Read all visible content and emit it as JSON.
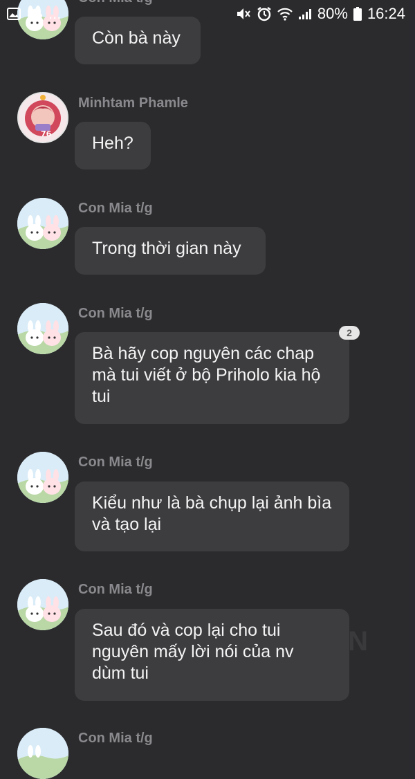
{
  "status_bar": {
    "battery": "80%",
    "time": "16:24",
    "left_text": "..."
  },
  "watermark": "ON",
  "messages": [
    {
      "sender": "Con Mia t/g",
      "text": "Còn bà này"
    },
    {
      "sender": "Minhtam Phamle",
      "text": "Heh?"
    },
    {
      "sender": "Con Mia t/g",
      "text": "Trong thời gian này"
    },
    {
      "sender": "Con Mia t/g",
      "text": "Bà hãy cop nguyên các chap mà tui viết ở bộ Priholo kia hộ tui",
      "badge": "2"
    },
    {
      "sender": "Con Mia t/g",
      "text": "Kiểu như là bà chụp lại ảnh bìa và tạo lại"
    },
    {
      "sender": "Con Mia t/g",
      "text": "Sau đó và cop lại cho tui nguyên mấy lời nói của nv dùm tui"
    },
    {
      "sender": "Con Mia t/g",
      "text": ""
    }
  ],
  "icons": [
    "photo-icon",
    "cloud-icon",
    "mute-icon",
    "alarm-icon",
    "wifi-icon",
    "signal-icon",
    "battery-icon",
    "bunny-avatar",
    "anime-avatar",
    "reply-icon"
  ]
}
